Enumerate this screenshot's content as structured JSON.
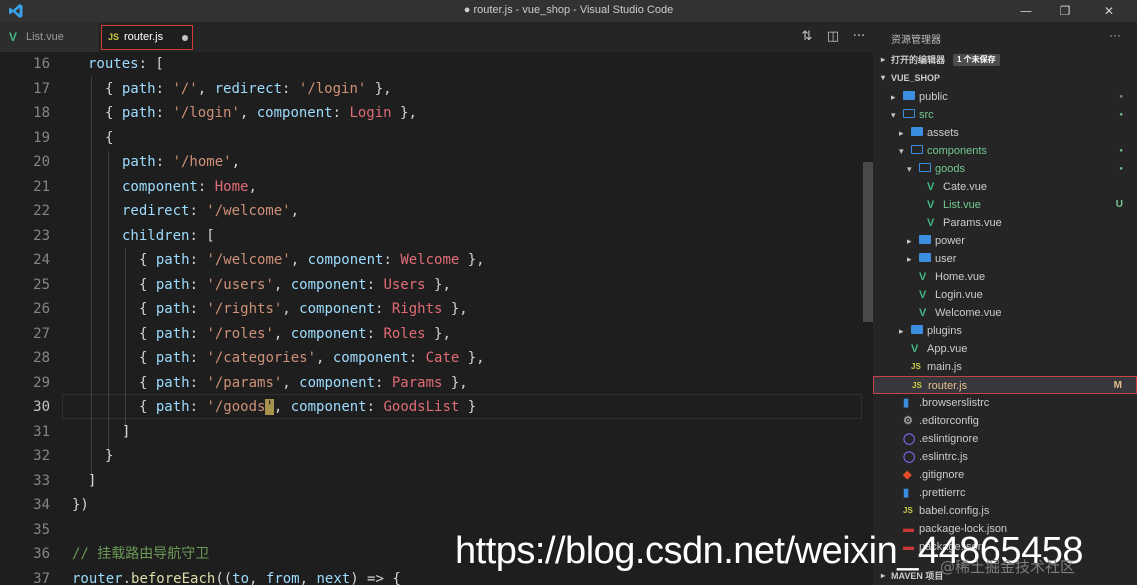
{
  "window": {
    "title": "● router.js - vue_shop - Visual Studio Code",
    "minimize": "—",
    "maximize": "❐",
    "close": "✕"
  },
  "tabs": [
    {
      "label": "List.vue",
      "icon": "vue-icon"
    },
    {
      "label": "router.js",
      "icon": "js-icon",
      "js_badge": "JS",
      "modified": true
    }
  ],
  "toolbar": {
    "compare": "⇅",
    "split": "◫",
    "more": "···"
  },
  "editor": {
    "lines": [
      {
        "n": "16"
      },
      {
        "n": "17"
      },
      {
        "n": "18"
      },
      {
        "n": "19"
      },
      {
        "n": "20"
      },
      {
        "n": "21"
      },
      {
        "n": "22"
      },
      {
        "n": "23"
      },
      {
        "n": "24"
      },
      {
        "n": "25"
      },
      {
        "n": "26"
      },
      {
        "n": "27"
      },
      {
        "n": "28"
      },
      {
        "n": "29"
      },
      {
        "n": "30"
      },
      {
        "n": "31"
      },
      {
        "n": "32"
      },
      {
        "n": "33"
      },
      {
        "n": "34"
      },
      {
        "n": "35"
      },
      {
        "n": "36"
      },
      {
        "n": "37"
      }
    ],
    "code": {
      "l16": [
        "routes",
        ": ["
      ],
      "l17": [
        "{ ",
        "path",
        ": ",
        "'/'",
        ", ",
        "redirect",
        ": ",
        "'/login'",
        " },"
      ],
      "l18": [
        "{ ",
        "path",
        ": ",
        "'/login'",
        ", ",
        "component",
        ": ",
        "Login",
        " },"
      ],
      "l19": [
        "{"
      ],
      "l20": [
        "path",
        ": ",
        "'/home'",
        ","
      ],
      "l21": [
        "component",
        ": ",
        "Home",
        ","
      ],
      "l22": [
        "redirect",
        ": ",
        "'/welcome'",
        ","
      ],
      "l23": [
        "children",
        ": ["
      ],
      "l24": [
        "{ ",
        "path",
        ": ",
        "'/welcome'",
        ", ",
        "component",
        ": ",
        "Welcome",
        " },"
      ],
      "l25": [
        "{ ",
        "path",
        ": ",
        "'/users'",
        ", ",
        "component",
        ": ",
        "Users",
        " },"
      ],
      "l26": [
        "{ ",
        "path",
        ": ",
        "'/rights'",
        ", ",
        "component",
        ": ",
        "Rights",
        " },"
      ],
      "l27": [
        "{ ",
        "path",
        ": ",
        "'/roles'",
        ", ",
        "component",
        ": ",
        "Roles",
        " },"
      ],
      "l28": [
        "{ ",
        "path",
        ": ",
        "'/categories'",
        ", ",
        "component",
        ": ",
        "Cate",
        " },"
      ],
      "l29": [
        "{ ",
        "path",
        ": ",
        "'/params'",
        ", ",
        "component",
        ": ",
        "Params",
        " },"
      ],
      "l30": [
        "{ ",
        "path",
        ": ",
        "'/goods",
        "'",
        ", ",
        "component",
        ": ",
        "GoodsList",
        " }"
      ],
      "l31": [
        "]"
      ],
      "l32": [
        "}"
      ],
      "l33": [
        "]"
      ],
      "l34": [
        "})"
      ],
      "l35": [
        ""
      ],
      "l36": [
        "// 挂载路由导航守卫"
      ],
      "l37": [
        "router",
        ".",
        "beforeEach",
        "((",
        "to",
        ", ",
        "from",
        ", ",
        "next",
        ") => {"
      ]
    }
  },
  "sidebar": {
    "title": "资源管理器",
    "more": "···",
    "open_editors": {
      "label": "打开的编辑器",
      "badge": "1 个未保存"
    },
    "project": "VUE_SHOP",
    "outline": "MAVEN 项目",
    "tree": [
      {
        "name": "public",
        "kind": "folder",
        "status": "dot"
      },
      {
        "name": "src",
        "kind": "folder-open",
        "status": "dot"
      },
      {
        "name": "assets",
        "kind": "folder"
      },
      {
        "name": "components",
        "kind": "folder-open",
        "status": "dot"
      },
      {
        "name": "goods",
        "kind": "folder-open",
        "status": "dot"
      },
      {
        "name": "Cate.vue",
        "kind": "vue"
      },
      {
        "name": "List.vue",
        "kind": "vue",
        "status": "U"
      },
      {
        "name": "Params.vue",
        "kind": "vue"
      },
      {
        "name": "power",
        "kind": "folder"
      },
      {
        "name": "user",
        "kind": "folder"
      },
      {
        "name": "Home.vue",
        "kind": "vue"
      },
      {
        "name": "Login.vue",
        "kind": "vue"
      },
      {
        "name": "Welcome.vue",
        "kind": "vue"
      },
      {
        "name": "plugins",
        "kind": "folder"
      },
      {
        "name": "App.vue",
        "kind": "vue"
      },
      {
        "name": "main.js",
        "kind": "js"
      },
      {
        "name": "router.js",
        "kind": "js",
        "status": "M"
      },
      {
        "name": ".browserslistrc",
        "kind": "file"
      },
      {
        "name": ".editorconfig",
        "kind": "gear"
      },
      {
        "name": ".eslintignore",
        "kind": "eslint"
      },
      {
        "name": ".eslintrc.js",
        "kind": "eslint"
      },
      {
        "name": ".gitignore",
        "kind": "git"
      },
      {
        "name": ".prettierrc",
        "kind": "file"
      },
      {
        "name": "babel.config.js",
        "kind": "js"
      },
      {
        "name": "package-lock.json",
        "kind": "npm"
      },
      {
        "name": "package.json",
        "kind": "npm"
      }
    ]
  },
  "watermark": "https://blog.csdn.net/weixin_44865458",
  "watermark_juejin": "@稀土掘金技术社区",
  "colors": {
    "accent_tab_border": "#d33b3b",
    "vue": "#41b883",
    "js": "#cbcb41",
    "folder": "#3c8fe0",
    "modified": "#e2c08d",
    "untracked": "#73c991"
  }
}
